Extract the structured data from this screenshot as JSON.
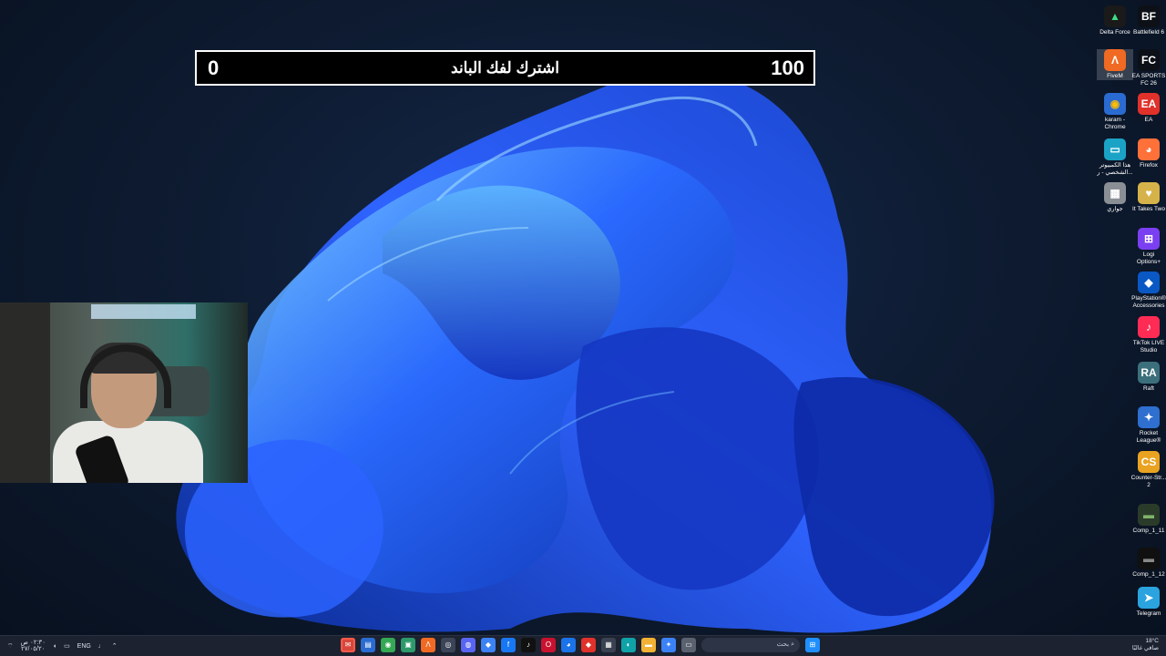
{
  "subscribe_bar": {
    "left_value": "0",
    "title": "اشترك لفك الباند",
    "right_value": "100"
  },
  "desktop_icons_col1": [
    {
      "label": "Delta Force",
      "glyph": "▲",
      "color": "#1a1a1a",
      "fg": "#3ddc84"
    },
    {
      "label": "FiveM",
      "glyph": "Λ",
      "color": "#f06a23",
      "fg": "#ffffff"
    },
    {
      "label": "karam - Chrome",
      "glyph": "◉",
      "color": "#2a6bd1",
      "fg": "#fbbc05"
    },
    {
      "label": "هذا الكمبيوتر الشخصي - ر...",
      "glyph": "▭",
      "color": "#1ba3c6",
      "fg": "#ffffff"
    },
    {
      "label": "جواري",
      "glyph": "▦",
      "color": "#8a8f96",
      "fg": "#ffffff"
    }
  ],
  "desktop_icons_col2": [
    {
      "label": "Battlefield 6",
      "glyph": "BF",
      "color": "#0d1117",
      "fg": "#ffffff"
    },
    {
      "label": "EA SPORTS FC 26",
      "glyph": "FC",
      "color": "#0d1117",
      "fg": "#ffffff"
    },
    {
      "label": "EA",
      "glyph": "EA",
      "color": "#e0312b",
      "fg": "#ffffff"
    },
    {
      "label": "Firefox",
      "glyph": "◕",
      "color": "#ff7139",
      "fg": "#ffffff"
    },
    {
      "label": "It Takes Two",
      "glyph": "♥",
      "color": "#d6b34a",
      "fg": "#ffffff"
    },
    {
      "label": "Logi Options+",
      "glyph": "⊞",
      "color": "#7b3ff2",
      "fg": "#ffffff"
    },
    {
      "label": "PlayStation® Accessories",
      "glyph": "◆",
      "color": "#0a58c4",
      "fg": "#ffffff"
    },
    {
      "label": "TikTok LIVE Studio",
      "glyph": "♪",
      "color": "#fe2c55",
      "fg": "#ffffff"
    },
    {
      "label": "Raft",
      "glyph": "RA",
      "color": "#3c6f7c",
      "fg": "#ffffff"
    },
    {
      "label": "Rocket League®",
      "glyph": "✦",
      "color": "#2e6fcf",
      "fg": "#ffffff"
    },
    {
      "label": "Counter-Str... 2",
      "glyph": "CS",
      "color": "#e9a321",
      "fg": "#ffffff"
    },
    {
      "label": "Comp_1_11",
      "glyph": "▬",
      "color": "#2b3b2a",
      "fg": "#7fb36a"
    },
    {
      "label": "Comp_1_12",
      "glyph": "▬",
      "color": "#101010",
      "fg": "#888888"
    },
    {
      "label": "Telegram",
      "glyph": "➤",
      "color": "#2aa3df",
      "fg": "#ffffff"
    }
  ],
  "taskbar": {
    "time": "٠٢:٣٠ ص",
    "date": "٢٧/٠٥/٢٠",
    "language": "ENG",
    "search_placeholder": "بحث",
    "weather_temp": "18°C",
    "weather_desc": "صافي غالبًا",
    "apps": [
      {
        "name": "mail-icon",
        "glyph": "✉",
        "color": "#d9463b"
      },
      {
        "name": "folder-icon",
        "glyph": "▤",
        "color": "#2a6bd1"
      },
      {
        "name": "chrome-icon",
        "glyph": "◉",
        "color": "#34a853"
      },
      {
        "name": "terminal-icon",
        "glyph": "▣",
        "color": "#2c9a6a"
      },
      {
        "name": "fivem-icon",
        "glyph": "Λ",
        "color": "#f06a23"
      },
      {
        "name": "steam-icon",
        "glyph": "◎",
        "color": "#3b4557"
      },
      {
        "name": "discord-icon",
        "glyph": "◍",
        "color": "#5865f2"
      },
      {
        "name": "shield-icon",
        "glyph": "◆",
        "color": "#3b82f6"
      },
      {
        "name": "facebook-icon",
        "glyph": "f",
        "color": "#1877f2"
      },
      {
        "name": "tiktok-icon",
        "glyph": "♪",
        "color": "#111111"
      },
      {
        "name": "opera-icon",
        "glyph": "O",
        "color": "#c9122f"
      },
      {
        "name": "globe-icon",
        "glyph": "◕",
        "color": "#1a73e8"
      },
      {
        "name": "red-icon",
        "glyph": "◆",
        "color": "#e0312b"
      },
      {
        "name": "store-icon",
        "glyph": "▦",
        "color": "#3a4150"
      },
      {
        "name": "edge-icon",
        "glyph": "◐",
        "color": "#0fa3a8"
      },
      {
        "name": "explorer-icon",
        "glyph": "▬",
        "color": "#f2b233"
      },
      {
        "name": "photo-icon",
        "glyph": "✦",
        "color": "#3b82f6"
      },
      {
        "name": "window-icon",
        "glyph": "▭",
        "color": "#5a6270"
      }
    ]
  }
}
